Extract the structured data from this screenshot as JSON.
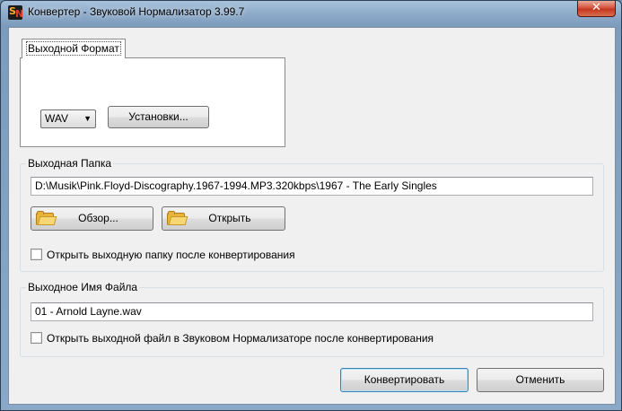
{
  "window": {
    "title": "Конвертер - Звуковой Нормализатор 3.99.7",
    "close_symbol": "✕",
    "icon": {
      "name": "app-icon",
      "letters": [
        "S",
        "N"
      ],
      "colors": [
        "#ffb21e",
        "#e23b2a"
      ]
    }
  },
  "output_format": {
    "tab_label": "Выходной Формат",
    "format_value": "WAV",
    "settings_button": "Установки..."
  },
  "output_folder": {
    "group_label": "Выходная Папка",
    "path": "D:\\Musik\\Pink.Floyd-Discography.1967-1994.MP3.320kbps\\1967 - The Early Singles",
    "browse_button": "Обзор...",
    "open_button": "Открыть",
    "open_after_label": "Открыть выходную папку после конвертирования",
    "open_after_checked": false
  },
  "output_filename": {
    "group_label": "Выходное Имя Файла",
    "filename": "01 - Arnold Layne.wav",
    "open_after_label": "Открыть выходной файл в Звуковом Нормализаторе после конвертирования",
    "open_after_checked": false
  },
  "actions": {
    "convert_button": "Конвертировать",
    "cancel_button": "Отменить"
  },
  "colors": {
    "accent_border": "#3c7fb1",
    "close_button": "#c3381f",
    "folder_icon": "#e8b43a"
  }
}
